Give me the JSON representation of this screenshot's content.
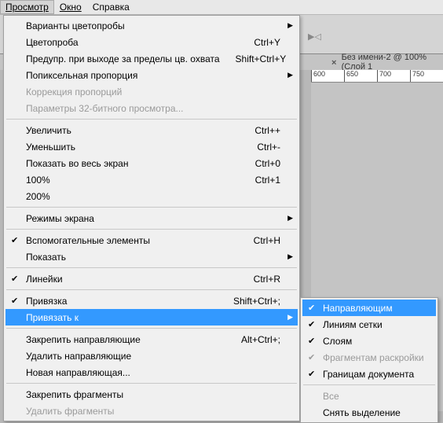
{
  "menubar": {
    "view": "Просмотр",
    "window": "Окно",
    "help": "Справка"
  },
  "document": {
    "tab_title": "Без имени-2 @ 100% (Слой 1",
    "ruler_ticks": [
      "600",
      "650",
      "700",
      "750"
    ]
  },
  "view_menu": [
    {
      "type": "item",
      "label": "Варианты цветопробы",
      "submenu": true
    },
    {
      "type": "item",
      "label": "Цветопроба",
      "shortcut": "Ctrl+Y"
    },
    {
      "type": "item",
      "label": "Предупр. при выходе за пределы цв. охвата",
      "shortcut": "Shift+Ctrl+Y"
    },
    {
      "type": "item",
      "label": "Попиксельная пропорция",
      "submenu": true
    },
    {
      "type": "item",
      "label": "Коррекция пропорций",
      "disabled": true
    },
    {
      "type": "item",
      "label": "Параметры 32-битного просмотра...",
      "disabled": true
    },
    {
      "type": "sep"
    },
    {
      "type": "item",
      "label": "Увеличить",
      "shortcut": "Ctrl++"
    },
    {
      "type": "item",
      "label": "Уменьшить",
      "shortcut": "Ctrl+-"
    },
    {
      "type": "item",
      "label": "Показать во весь экран",
      "shortcut": "Ctrl+0"
    },
    {
      "type": "item",
      "label": "100%",
      "shortcut": "Ctrl+1"
    },
    {
      "type": "item",
      "label": "200%"
    },
    {
      "type": "sep"
    },
    {
      "type": "item",
      "label": "Режимы экрана",
      "submenu": true
    },
    {
      "type": "sep"
    },
    {
      "type": "item",
      "label": "Вспомогательные элементы",
      "shortcut": "Ctrl+H",
      "checked": true
    },
    {
      "type": "item",
      "label": "Показать",
      "submenu": true
    },
    {
      "type": "sep"
    },
    {
      "type": "item",
      "label": "Линейки",
      "shortcut": "Ctrl+R",
      "checked": true
    },
    {
      "type": "sep"
    },
    {
      "type": "item",
      "label": "Привязка",
      "shortcut": "Shift+Ctrl+;",
      "checked": true
    },
    {
      "type": "item",
      "label": "Привязать к",
      "submenu": true,
      "highlight": true
    },
    {
      "type": "sep"
    },
    {
      "type": "item",
      "label": "Закрепить направляющие",
      "shortcut": "Alt+Ctrl+;"
    },
    {
      "type": "item",
      "label": "Удалить направляющие"
    },
    {
      "type": "item",
      "label": "Новая направляющая..."
    },
    {
      "type": "sep"
    },
    {
      "type": "item",
      "label": "Закрепить фрагменты"
    },
    {
      "type": "item",
      "label": "Удалить фрагменты",
      "disabled": true
    }
  ],
  "snap_submenu": [
    {
      "type": "item",
      "label": "Направляющим",
      "checked": true,
      "highlight": true
    },
    {
      "type": "item",
      "label": "Линиям сетки",
      "checked": true
    },
    {
      "type": "item",
      "label": "Слоям",
      "checked": true
    },
    {
      "type": "item",
      "label": "Фрагментам раскройки",
      "checked": true,
      "disabled": true
    },
    {
      "type": "item",
      "label": "Границам документа",
      "checked": true
    },
    {
      "type": "sep"
    },
    {
      "type": "item",
      "label": "Все",
      "disabled": true
    },
    {
      "type": "item",
      "label": "Снять выделение"
    }
  ]
}
